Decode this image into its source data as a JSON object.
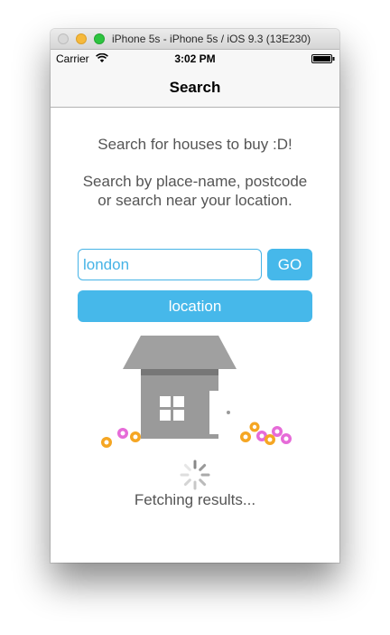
{
  "window": {
    "title": "iPhone 5s - iPhone 5s / iOS 9.3 (13E230)"
  },
  "status_bar": {
    "carrier": "Carrier",
    "time": "3:02 PM",
    "icons": [
      "wifi-icon",
      "battery-icon"
    ]
  },
  "nav": {
    "title": "Search"
  },
  "main": {
    "intro": "Search for houses to buy :D!",
    "description": "Search by place-name, postcode or search near your location.",
    "search": {
      "value": "london",
      "placeholder": ""
    },
    "go_label": "GO",
    "location_label": "location",
    "illustration": "house-icon",
    "loading_text": "Fetching results..."
  },
  "colors": {
    "accent": "#46b8ea",
    "body_text": "#555555",
    "house": "#9a9a9a",
    "flower_orange": "#f5a623",
    "flower_pink": "#e66bd8"
  }
}
